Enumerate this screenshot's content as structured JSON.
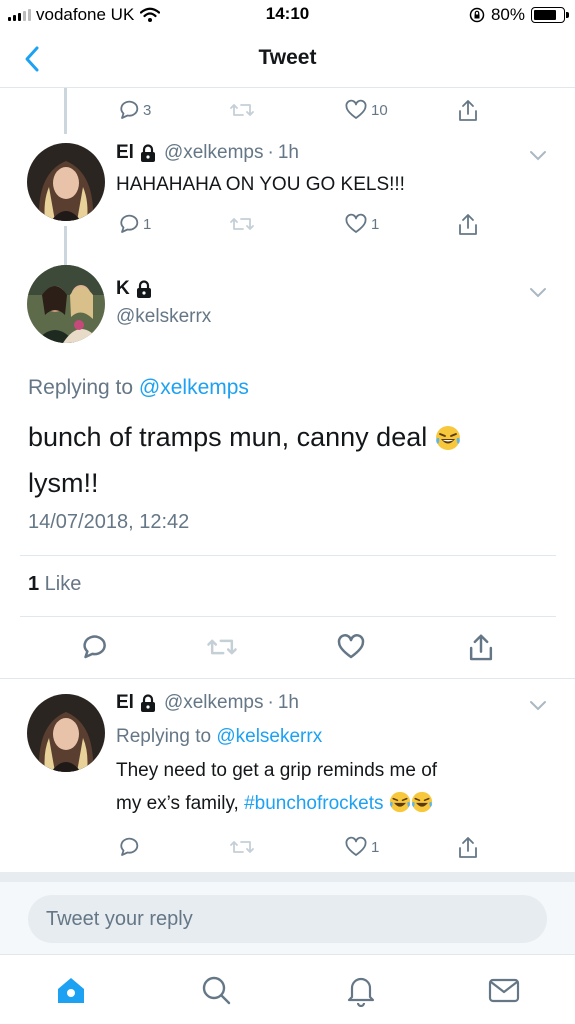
{
  "status_bar": {
    "carrier": "vodafone UK",
    "time": "14:10",
    "battery": "80%"
  },
  "nav": {
    "title": "Tweet",
    "back_icon": "chevron-left-icon"
  },
  "top_actions": {
    "replies": "3",
    "likes": "10"
  },
  "tweets": [
    {
      "name": "El",
      "handle": "@xelkemps",
      "dot": "·",
      "time": "1h",
      "text": "HAHAHAHA ON YOU GO KELS!!!",
      "replies": "1",
      "likes": "1"
    },
    {
      "name": "El",
      "handle": "@xelkemps",
      "dot": "·",
      "time": "1h",
      "replying_prefix": "Replying to ",
      "replying_to": "@kelsekerrx",
      "text_part1": "They need to get a grip reminds me of",
      "text_part2": "my ex’s family, ",
      "hashtag": "#bunchofrockets",
      "replies": "",
      "likes": "1"
    }
  ],
  "focus_tweet": {
    "name": "K",
    "handle": "@kelskerrx",
    "replying_prefix": "Replying to ",
    "replying_to": "@xelkemps",
    "text_part1": "bunch of tramps mun, canny deal ",
    "text_part2": "lysm!!",
    "date": "14/07/2018, 12:42",
    "like_count": "1",
    "like_label": " Like"
  },
  "composer": {
    "placeholder": "Tweet your reply"
  },
  "tabs": [
    "home-icon",
    "search-icon",
    "notifications-icon",
    "messages-icon"
  ],
  "colors": {
    "accent": "#1da1f2",
    "muted": "#657786",
    "text": "#14171a"
  }
}
